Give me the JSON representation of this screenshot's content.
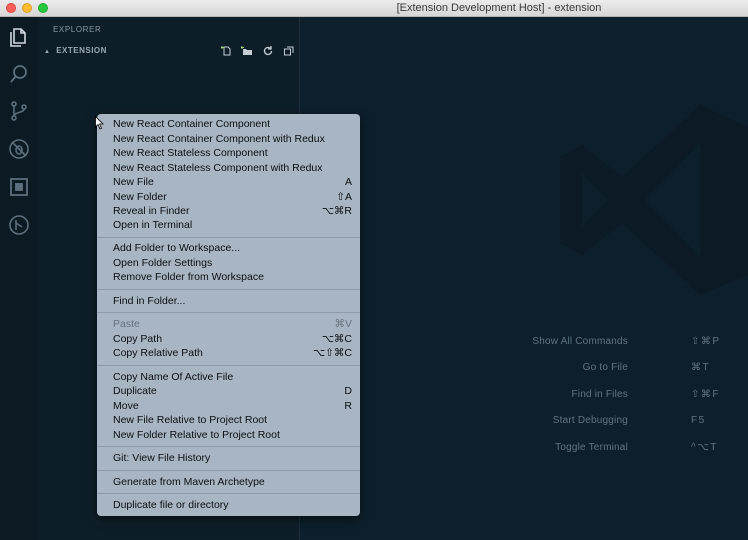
{
  "window": {
    "title": "[Extension Development Host] - extension"
  },
  "activity_bar": {
    "items": [
      {
        "name": "files-icon"
      },
      {
        "name": "search-icon"
      },
      {
        "name": "source-control-icon"
      },
      {
        "name": "debug-icon"
      },
      {
        "name": "extensions-icon"
      },
      {
        "name": "remote-icon"
      }
    ]
  },
  "sidebar": {
    "title": "EXPLORER",
    "section": "EXTENSION",
    "toolbar_icons": [
      "new-file-icon",
      "new-folder-icon",
      "refresh-icon",
      "collapse-all-icon"
    ]
  },
  "welcome": {
    "shortcuts": [
      {
        "label": "Show All Commands",
        "keys": "⇧⌘P"
      },
      {
        "label": "Go to File",
        "keys": "⌘T"
      },
      {
        "label": "Find in Files",
        "keys": "⇧⌘F"
      },
      {
        "label": "Start Debugging",
        "keys": "F5"
      },
      {
        "label": "Toggle Terminal",
        "keys": "^⌥T"
      }
    ]
  },
  "context_menu": {
    "groups": [
      [
        {
          "label": "New React Container Component",
          "key": ""
        },
        {
          "label": "New React Container Component with Redux",
          "key": ""
        },
        {
          "label": "New React Stateless Component",
          "key": ""
        },
        {
          "label": "New React Stateless Component with Redux",
          "key": ""
        },
        {
          "label": "New File",
          "key": "A"
        },
        {
          "label": "New Folder",
          "key": "⇧A"
        },
        {
          "label": "Reveal in Finder",
          "key": "⌥⌘R"
        },
        {
          "label": "Open in Terminal",
          "key": ""
        }
      ],
      [
        {
          "label": "Add Folder to Workspace...",
          "key": ""
        },
        {
          "label": "Open Folder Settings",
          "key": ""
        },
        {
          "label": "Remove Folder from Workspace",
          "key": ""
        }
      ],
      [
        {
          "label": "Find in Folder...",
          "key": ""
        }
      ],
      [
        {
          "label": "Paste",
          "key": "⌘V",
          "disabled": true
        },
        {
          "label": "Copy Path",
          "key": "⌥⌘C"
        },
        {
          "label": "Copy Relative Path",
          "key": "⌥⇧⌘C"
        }
      ],
      [
        {
          "label": "Copy Name Of Active File",
          "key": ""
        },
        {
          "label": "Duplicate",
          "key": "D"
        },
        {
          "label": "Move",
          "key": "R"
        },
        {
          "label": "New File Relative to Project Root",
          "key": ""
        },
        {
          "label": "New Folder Relative to Project Root",
          "key": ""
        }
      ],
      [
        {
          "label": "Git: View File History",
          "key": ""
        }
      ],
      [
        {
          "label": "Generate from Maven Archetype",
          "key": ""
        }
      ],
      [
        {
          "label": "Duplicate file or directory",
          "key": ""
        }
      ]
    ]
  },
  "colors": {
    "menu_bg": "#a8b5c2",
    "editor_bg": "#0d1f2b",
    "sidebar_bg": "#0e1e29"
  }
}
